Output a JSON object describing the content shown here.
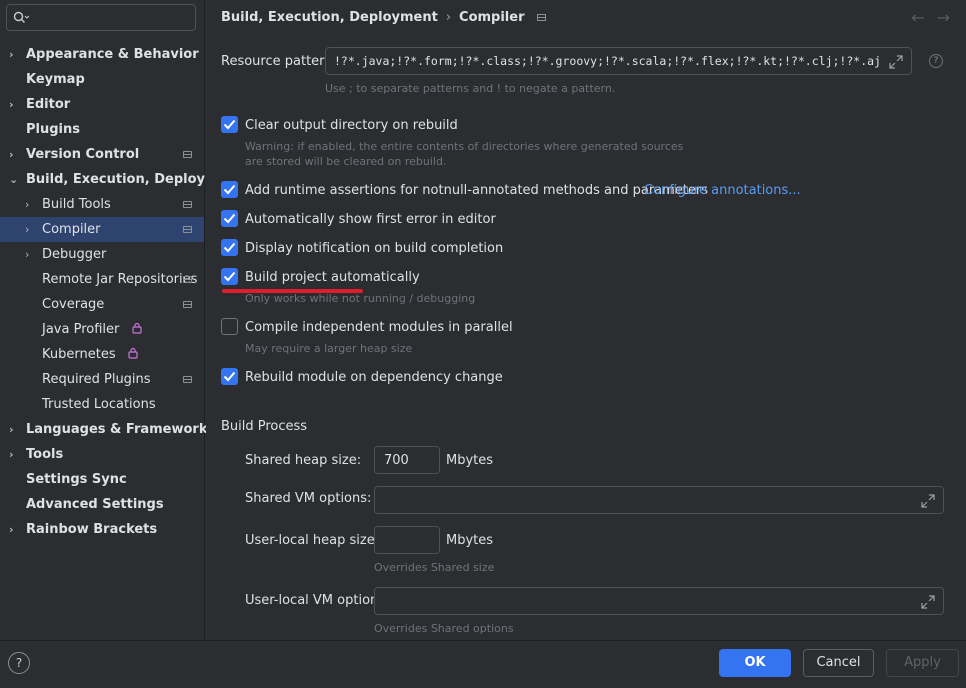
{
  "sidebar": {
    "search_value": "",
    "items": [
      {
        "label": "Appearance & Behavior",
        "chevron": "›"
      },
      {
        "label": "Keymap",
        "chevron": ""
      },
      {
        "label": "Editor",
        "chevron": "›"
      },
      {
        "label": "Plugins",
        "chevron": ""
      },
      {
        "label": "Version Control",
        "chevron": "›"
      },
      {
        "label": "Build, Execution, Deployment",
        "chevron": "⌄"
      },
      {
        "label": "Build Tools",
        "chevron": "›"
      },
      {
        "label": "Compiler",
        "chevron": "›"
      },
      {
        "label": "Debugger",
        "chevron": "›"
      },
      {
        "label": "Remote Jar Repositories",
        "chevron": ""
      },
      {
        "label": "Coverage",
        "chevron": ""
      },
      {
        "label": "Java Profiler",
        "chevron": ""
      },
      {
        "label": "Kubernetes",
        "chevron": ""
      },
      {
        "label": "Required Plugins",
        "chevron": ""
      },
      {
        "label": "Trusted Locations",
        "chevron": ""
      },
      {
        "label": "Languages & Frameworks",
        "chevron": "›"
      },
      {
        "label": "Tools",
        "chevron": "›"
      },
      {
        "label": "Settings Sync",
        "chevron": ""
      },
      {
        "label": "Advanced Settings",
        "chevron": ""
      },
      {
        "label": "Rainbow Brackets",
        "chevron": "›"
      }
    ]
  },
  "breadcrumb": {
    "parent": "Build, Execution, Deployment",
    "separator": "›",
    "current": "Compiler"
  },
  "nav": {
    "back": "←",
    "forward": "→"
  },
  "resource_patterns": {
    "label": "Resource patterns:",
    "value": "!?*.java;!?*.form;!?*.class;!?*.groovy;!?*.scala;!?*.flex;!?*.kt;!?*.clj;!?*.aj",
    "hint": "Use ; to separate patterns and ! to negate a pattern."
  },
  "options": {
    "clear_output": {
      "label": "Clear output directory on rebuild",
      "checked": true,
      "hint1": "Warning: if enabled, the entire contents of directories where generated sources",
      "hint2": "are stored will be cleared on rebuild."
    },
    "runtime_assertions": {
      "label": "Add runtime assertions for notnull-annotated methods and parameters",
      "checked": true,
      "link": "Configure annotations..."
    },
    "show_first_error": {
      "label": "Automatically show first error in editor",
      "checked": true
    },
    "display_notification": {
      "label": "Display notification on build completion",
      "checked": true
    },
    "build_automatically": {
      "label": "Build project automatically",
      "checked": true,
      "hint": "Only works while not running / debugging"
    },
    "compile_parallel": {
      "label": "Compile independent modules in parallel",
      "checked": false,
      "hint": "May require a larger heap size"
    },
    "rebuild_module": {
      "label": "Rebuild module on dependency change",
      "checked": true
    }
  },
  "build_process": {
    "title": "Build Process",
    "shared_heap": {
      "label": "Shared heap size:",
      "value": "700",
      "unit": "Mbytes"
    },
    "shared_vm": {
      "label": "Shared VM options:",
      "value": ""
    },
    "user_heap": {
      "label": "User-local heap size:",
      "value": "",
      "unit": "Mbytes",
      "hint": "Overrides Shared size"
    },
    "user_vm": {
      "label": "User-local VM options:",
      "value": "",
      "hint": "Overrides Shared options"
    }
  },
  "footer": {
    "help": "?",
    "ok": "OK",
    "cancel": "Cancel",
    "apply": "Apply"
  },
  "colors": {
    "accent": "#3574f0",
    "selection": "#2e436e",
    "link": "#589df6",
    "annotation": "#e01d2c"
  }
}
